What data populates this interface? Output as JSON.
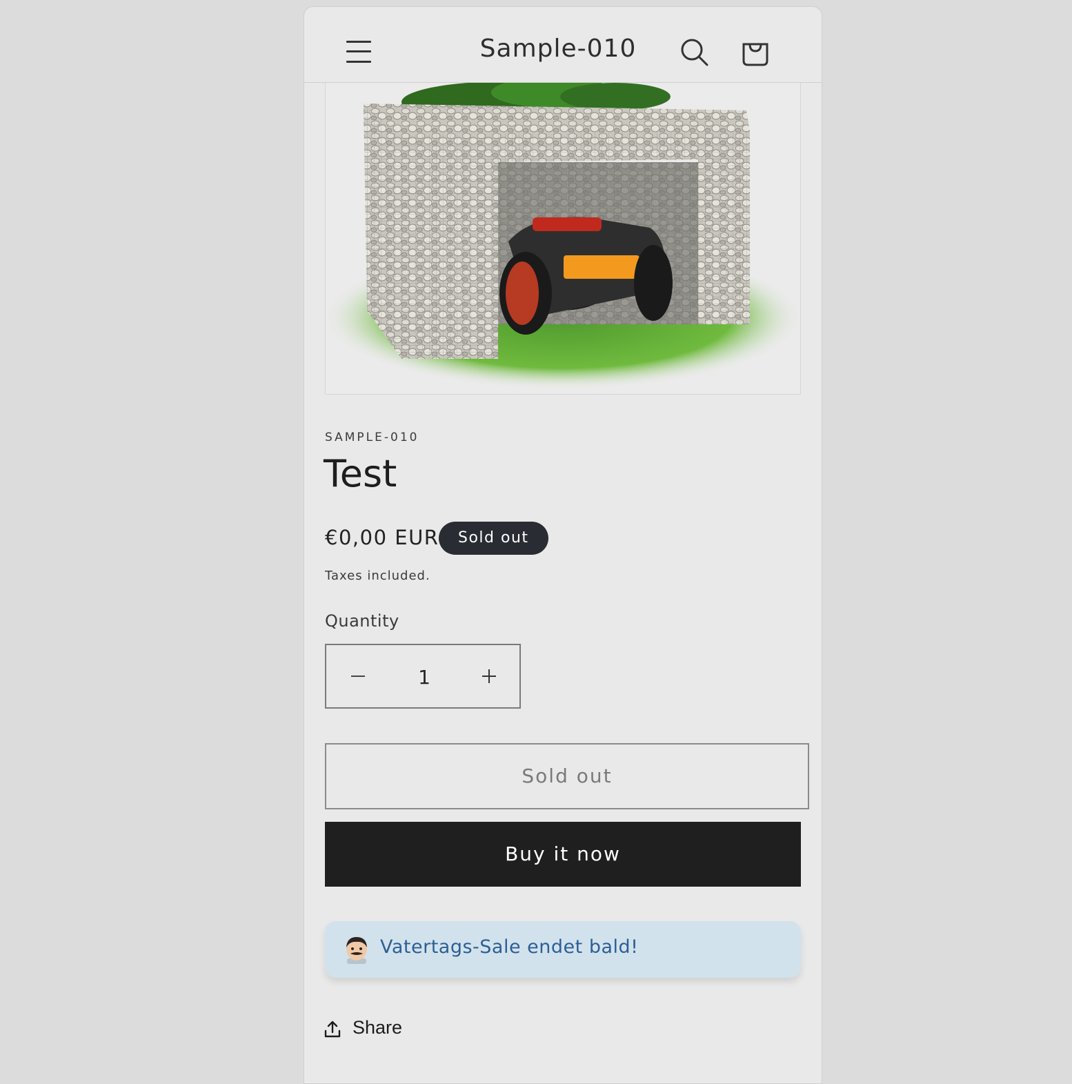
{
  "header": {
    "store_title": "Sample-010",
    "menu_icon": "hamburger-menu-icon",
    "search_icon": "search-icon",
    "cart_icon": "shopping-bag-icon"
  },
  "product": {
    "image_alt": "Gabion robotic lawn mower garage with plants on top",
    "vendor": "SAMPLE-010",
    "title": "Test",
    "price": "€0,00 EUR",
    "badge": "Sold out",
    "taxes": "Taxes included.",
    "quantity_label": "Quantity",
    "quantity_value": "1",
    "sold_out_button": "Sold out",
    "buy_now_button": "Buy it now"
  },
  "promo": {
    "emoji": "man-with-mustache-emoji",
    "text": "Vatertags-Sale endet bald!"
  },
  "share": {
    "icon": "share-upload-icon",
    "label": "Share"
  },
  "colors": {
    "page_bg": "#dcdcdc",
    "card_bg": "#e9e9e9",
    "badge_bg": "#2a2c33",
    "buy_button_bg": "#1f1f1f",
    "promo_bg": "#d2e2ec",
    "promo_text": "#2c5f95"
  }
}
